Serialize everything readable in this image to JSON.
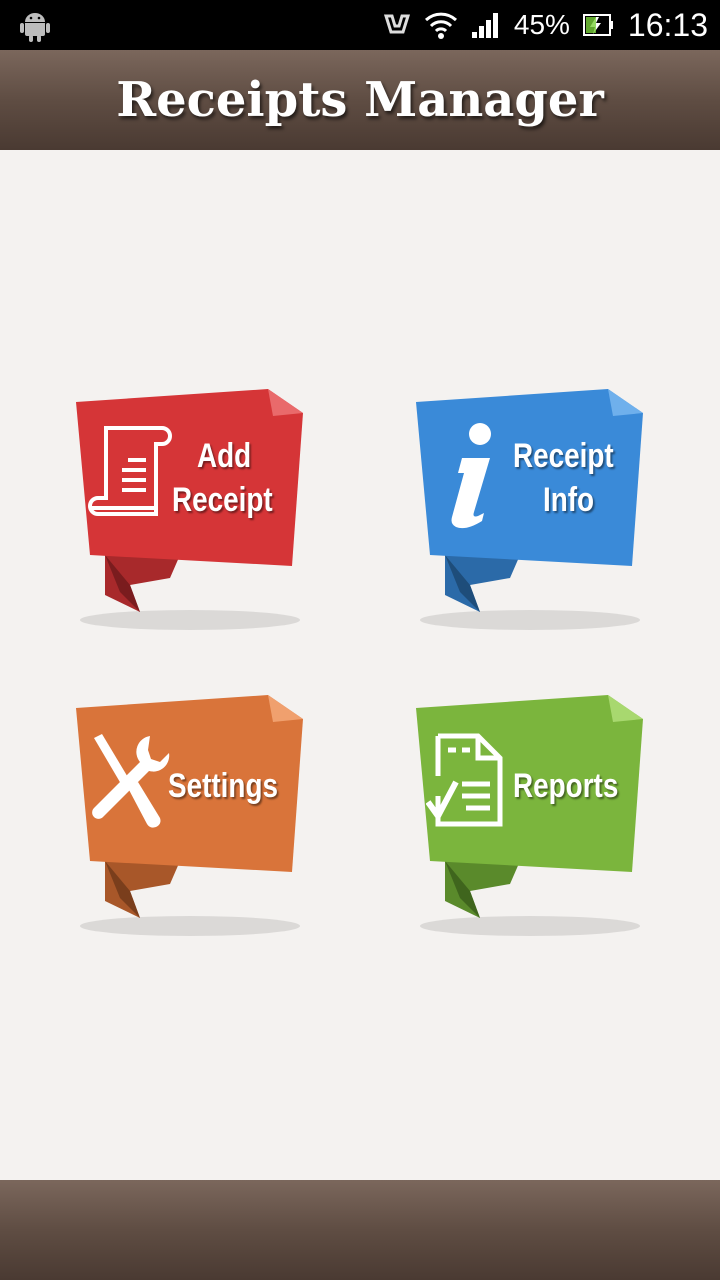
{
  "status_bar": {
    "battery_percent": "45%",
    "time": "16:13",
    "icons": [
      "android-icon",
      "nfc-icon",
      "wifi-icon",
      "signal-icon",
      "battery-icon"
    ]
  },
  "header": {
    "title": "Receipts Manager"
  },
  "menu": {
    "add_receipt": {
      "line1": "Add",
      "line2": "Receipt",
      "color": "#d53537",
      "icon": "receipt-scroll-icon"
    },
    "receipt_info": {
      "line1": "Receipt",
      "line2": "Info",
      "color": "#3a8ad8",
      "icon": "info-icon"
    },
    "settings": {
      "label": "Settings",
      "color": "#d9743a",
      "icon": "wrench-screwdriver-icon"
    },
    "reports": {
      "label": "Reports",
      "color": "#7bb53d",
      "icon": "report-document-icon"
    }
  }
}
